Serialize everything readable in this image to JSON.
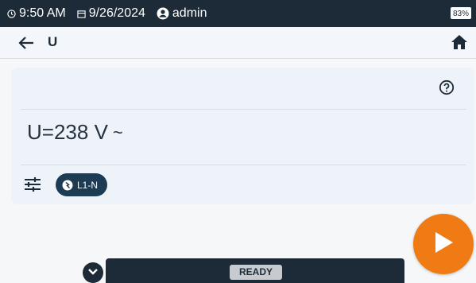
{
  "status_bar": {
    "time": "9:50 AM",
    "date": "9/26/2024",
    "user": "admin",
    "battery": "83%"
  },
  "nav": {
    "title": "U"
  },
  "measurement": {
    "reading": "U=238 V",
    "ac_symbol": "~"
  },
  "controls": {
    "phase_chip": "L1-N"
  },
  "bottom_panel": {
    "status": "READY"
  },
  "colors": {
    "status_bar": "#1d2b38",
    "accent_orange": "#f07b14",
    "chip_bg": "#1d3b52",
    "card_bg": "#edf3f9"
  },
  "icons": [
    "clock-icon",
    "calendar-icon",
    "user-icon",
    "back-arrow-icon",
    "home-icon",
    "help-icon",
    "settings-sliders-icon",
    "phase-icon",
    "play-icon",
    "chevron-down-icon"
  ]
}
